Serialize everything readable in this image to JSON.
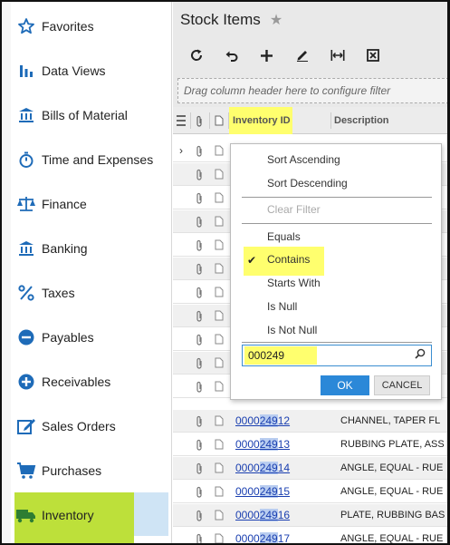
{
  "sidebar": {
    "items": [
      {
        "label": "Favorites",
        "icon": "star-icon"
      },
      {
        "label": "Data Views",
        "icon": "bar-chart-icon"
      },
      {
        "label": "Bills of Material",
        "icon": "bank-icon"
      },
      {
        "label": "Time and Expenses",
        "icon": "stopwatch-icon"
      },
      {
        "label": "Finance",
        "icon": "scales-icon"
      },
      {
        "label": "Banking",
        "icon": "bank-icon"
      },
      {
        "label": "Taxes",
        "icon": "percent-icon"
      },
      {
        "label": "Payables",
        "icon": "minus-circle-icon"
      },
      {
        "label": "Receivables",
        "icon": "plus-circle-icon"
      },
      {
        "label": "Sales Orders",
        "icon": "edit-icon"
      },
      {
        "label": "Purchases",
        "icon": "cart-icon"
      },
      {
        "label": "Inventory",
        "icon": "truck-icon"
      }
    ],
    "active": "Inventory"
  },
  "header": {
    "title": "Stock Items"
  },
  "toolbar": {
    "icons": [
      "refresh-icon",
      "undo-icon",
      "add-icon",
      "edit-icon",
      "fit-columns-icon",
      "export-icon"
    ]
  },
  "grid": {
    "drag_hint": "Drag column header here to configure filter",
    "columns": {
      "inventory_id": "Inventory ID",
      "description": "Description"
    },
    "visible_rows": [
      {
        "id_prefix": "0000",
        "id_match": "249",
        "id_suffix": "12",
        "description": "CHANNEL, TAPER FL"
      },
      {
        "id_prefix": "0000",
        "id_match": "249",
        "id_suffix": "13",
        "description": "RUBBING PLATE, ASS"
      },
      {
        "id_prefix": "0000",
        "id_match": "249",
        "id_suffix": "14",
        "description": "ANGLE, EQUAL - RUE"
      },
      {
        "id_prefix": "0000",
        "id_match": "249",
        "id_suffix": "15",
        "description": "ANGLE, EQUAL - RUE"
      },
      {
        "id_prefix": "0000",
        "id_match": "249",
        "id_suffix": "16",
        "description": "PLATE, RUBBING BAS"
      },
      {
        "id_prefix": "0000",
        "id_match": "249",
        "id_suffix": "17",
        "description": "ANGLE, EQUAL - RUE"
      }
    ]
  },
  "filter_menu": {
    "sort_asc": "Sort Ascending",
    "sort_desc": "Sort Descending",
    "clear_filter": "Clear Filter",
    "equals": "Equals",
    "contains": "Contains",
    "starts_with": "Starts With",
    "is_null": "Is Null",
    "is_not_null": "Is Not Null",
    "selected": "Contains",
    "check_mark": "✔",
    "value": "000249",
    "ok": "OK",
    "cancel": "CANCEL"
  },
  "colors": {
    "accent": "#2b88d8",
    "highlight": "#ffff6e",
    "inventory_highlight": "#bde03a",
    "link": "#1a3fb0"
  }
}
